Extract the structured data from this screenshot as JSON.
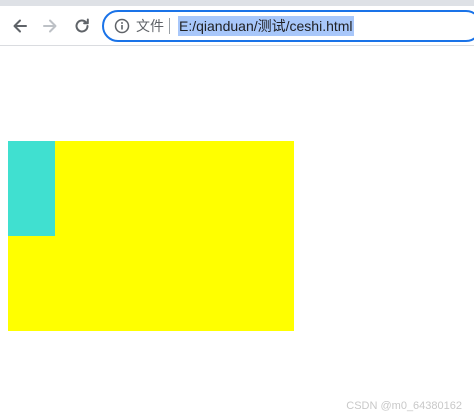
{
  "browser": {
    "address_bar": {
      "security_label": "文件",
      "url": "E:/qianduan/测试/ceshi.html"
    }
  },
  "colors": {
    "yellow_box": "#ffff00",
    "cyan_box": "#40e0d0",
    "address_selection": "#a8c7fa",
    "omnibox_focus": "#1a73e8"
  },
  "icons": {
    "back": "back-arrow-icon",
    "forward": "forward-arrow-icon",
    "reload": "reload-icon",
    "info": "info-icon"
  },
  "watermark": "CSDN @m0_64380162"
}
